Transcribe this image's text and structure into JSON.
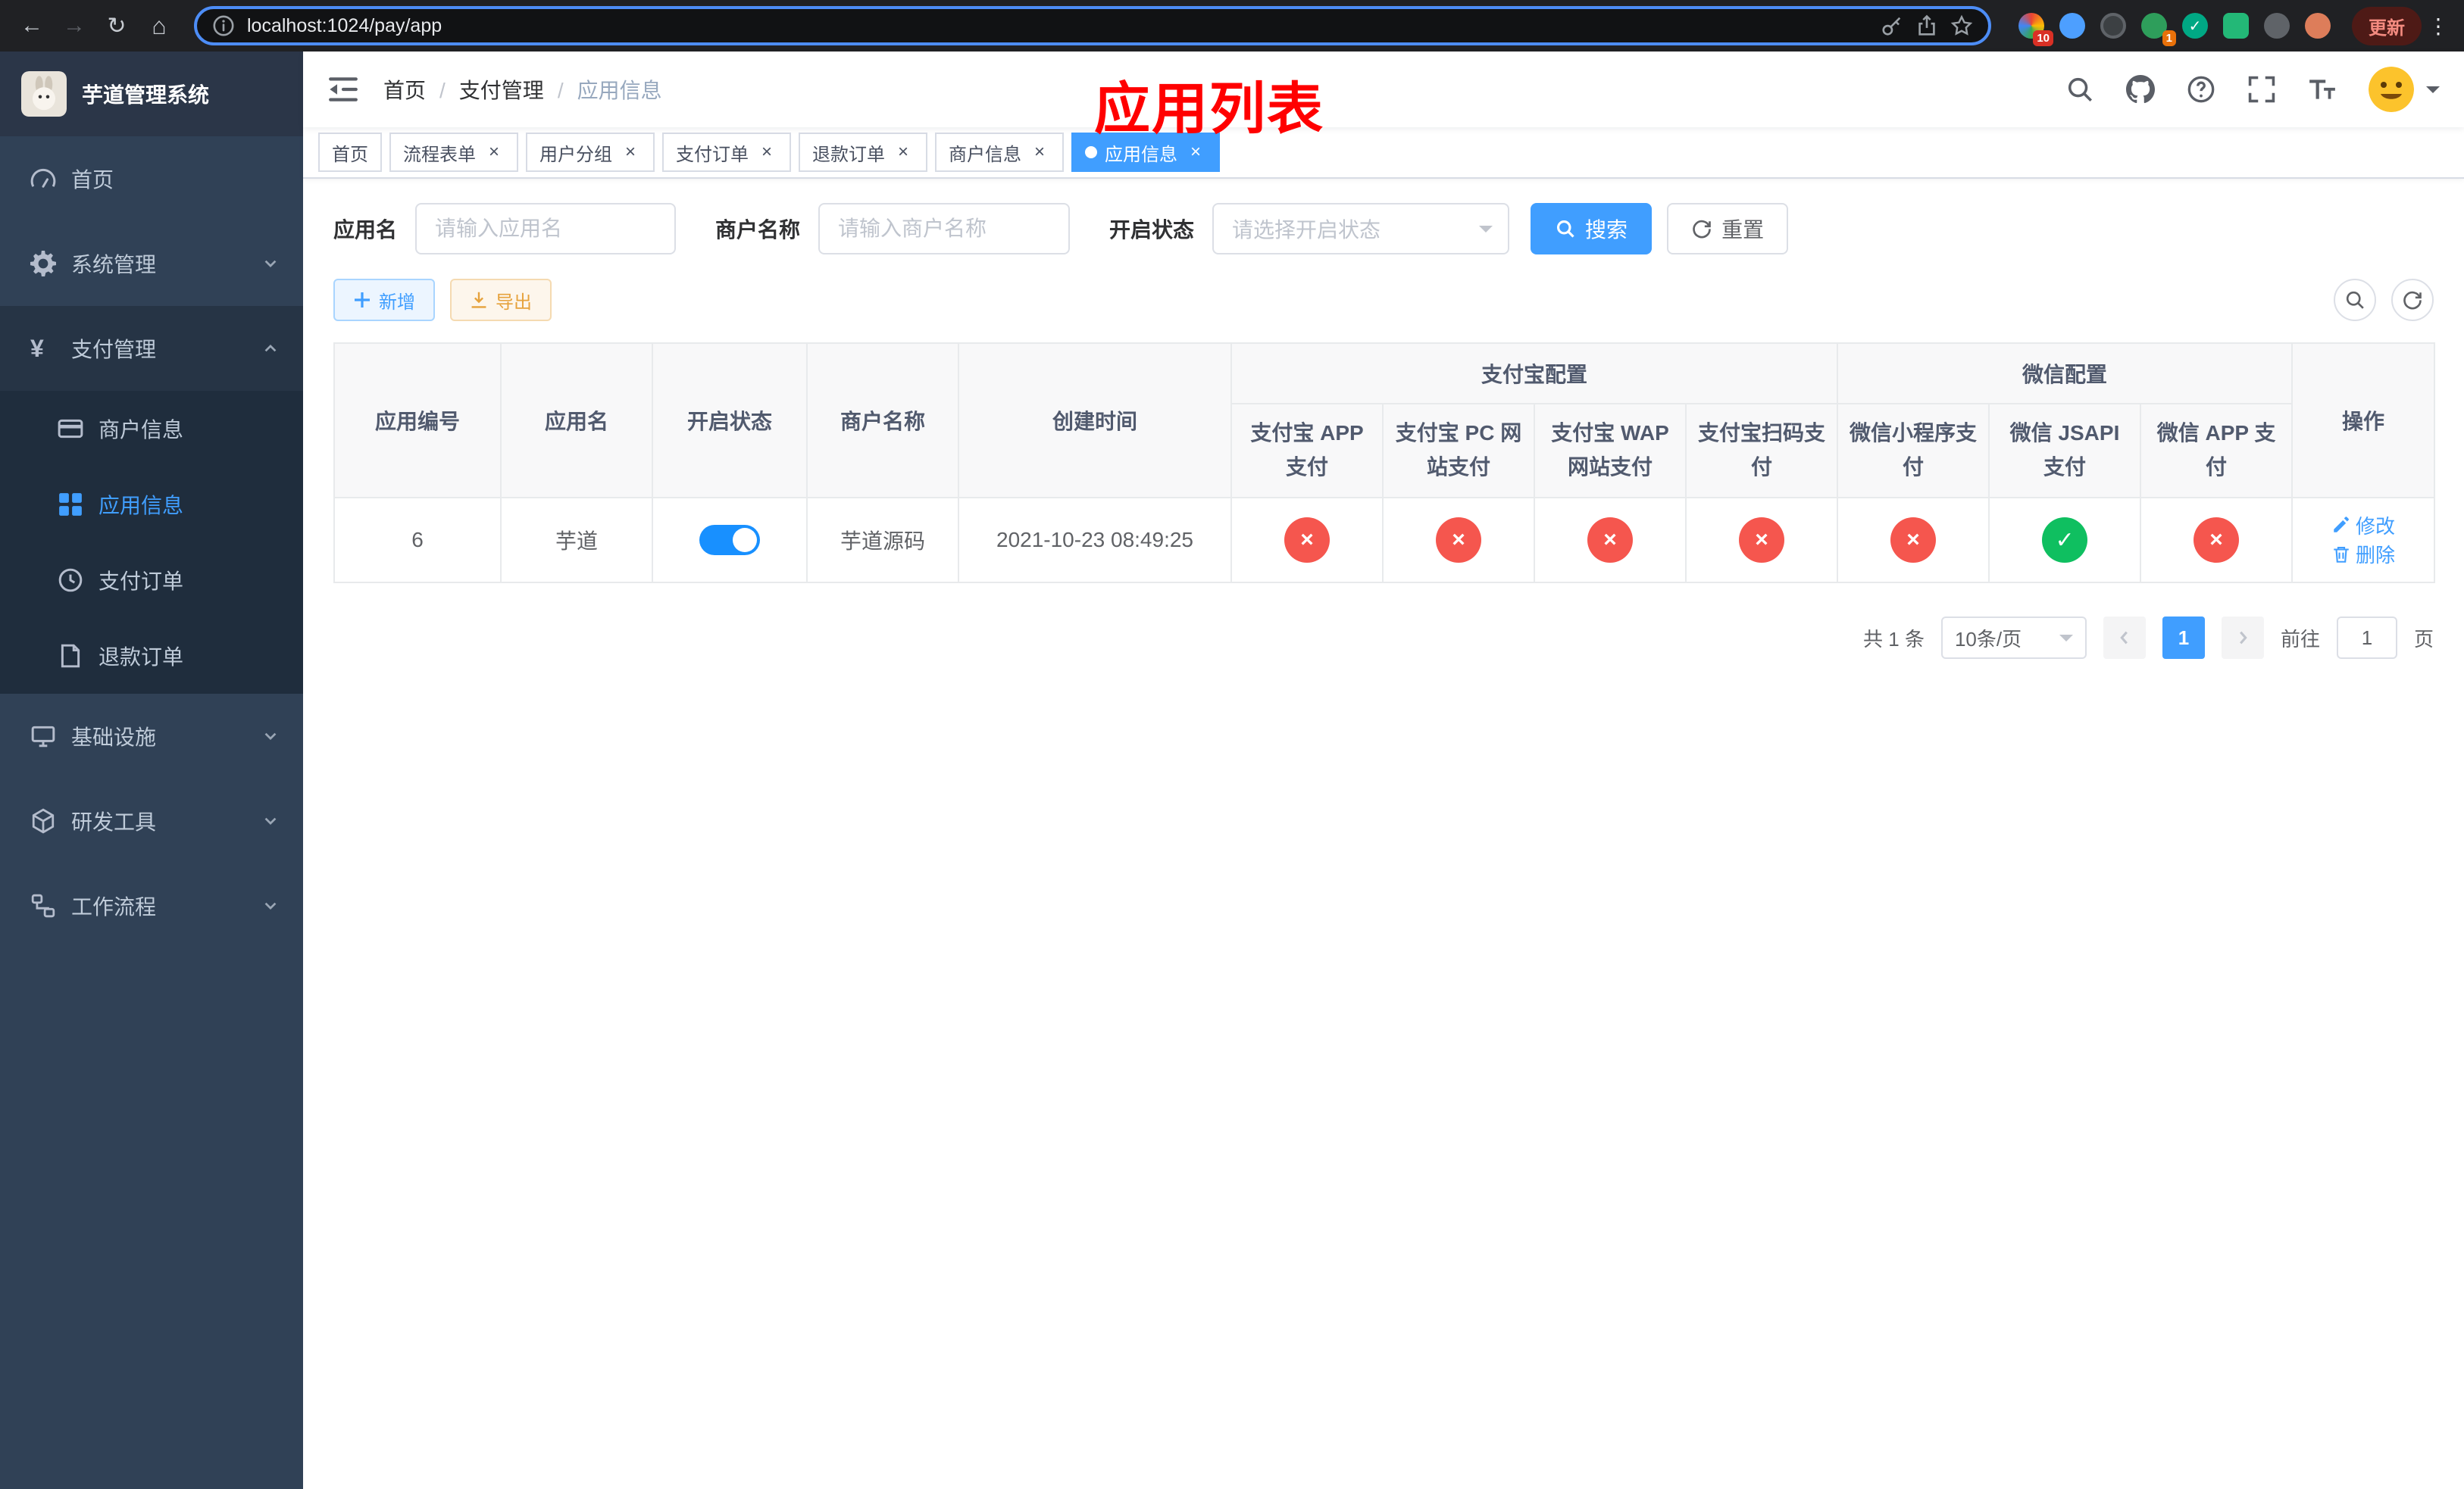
{
  "colors": {
    "accent": "#409eff",
    "toggle_on": "#1890ff",
    "danger": "#f5564e",
    "success": "#0fbf60",
    "annotation": "#ff0000",
    "sidebar_bg": "#304156",
    "submenu_bg": "#1f2d3d"
  },
  "browser": {
    "url": "localhost:1024/pay/app",
    "update_label": "更新",
    "ext_badge_1": "10",
    "ext_badge_2": "1"
  },
  "annotation": "应用列表",
  "sidebar": {
    "title": "芋道管理系统",
    "items": [
      {
        "label": "首页",
        "icon": "dashboard-icon"
      },
      {
        "label": "系统管理",
        "icon": "gear-icon"
      },
      {
        "label": "支付管理",
        "icon": "yen-icon",
        "children": [
          {
            "label": "商户信息",
            "icon": "bank-card-icon"
          },
          {
            "label": "应用信息",
            "icon": "grid-icon"
          },
          {
            "label": "支付订单",
            "icon": "clock-icon"
          },
          {
            "label": "退款订单",
            "icon": "document-icon"
          }
        ]
      },
      {
        "label": "基础设施",
        "icon": "monitor-icon"
      },
      {
        "label": "研发工具",
        "icon": "cube-icon"
      },
      {
        "label": "工作流程",
        "icon": "cube-icon"
      }
    ]
  },
  "navbar": {
    "breadcrumb": [
      "首页",
      "支付管理",
      "应用信息"
    ]
  },
  "tabs": [
    {
      "label": "首页"
    },
    {
      "label": "流程表单"
    },
    {
      "label": "用户分组"
    },
    {
      "label": "支付订单"
    },
    {
      "label": "退款订单"
    },
    {
      "label": "商户信息"
    },
    {
      "label": "应用信息"
    }
  ],
  "filters": {
    "app_name_label": "应用名",
    "app_name_placeholder": "请输入应用名",
    "merchant_label": "商户名称",
    "merchant_placeholder": "请输入商户名称",
    "status_label": "开启状态",
    "status_placeholder": "请选择开启状态",
    "search_label": "搜索",
    "reset_label": "重置"
  },
  "toolbar": {
    "add_label": "新增",
    "export_label": "导出"
  },
  "table": {
    "basic_columns": [
      "应用编号",
      "应用名",
      "开启状态",
      "商户名称",
      "创建时间"
    ],
    "alipay_group": "支付宝配置",
    "wechat_group": "微信配置",
    "alipay_columns": [
      "支付宝 APP 支付",
      "支付宝 PC 网站支付",
      "支付宝 WAP 网站支付",
      "支付宝扫码支付"
    ],
    "wechat_columns": [
      "微信小程序支付",
      "微信 JSAPI 支付",
      "微信 APP 支付"
    ],
    "action_column": "操作",
    "row": {
      "id": "6",
      "name": "芋道",
      "enabled": true,
      "merchant": "芋道源码",
      "created": "2021-10-23 08:49:25",
      "configs": [
        "no",
        "no",
        "no",
        "no",
        "no",
        "yes",
        "no"
      ],
      "edit_label": "修改",
      "delete_label": "删除"
    }
  },
  "pagination": {
    "total": "共 1 条",
    "page_size": "10条/页",
    "current_page": "1",
    "goto_label": "前往",
    "goto_value": "1",
    "page_unit": "页"
  }
}
